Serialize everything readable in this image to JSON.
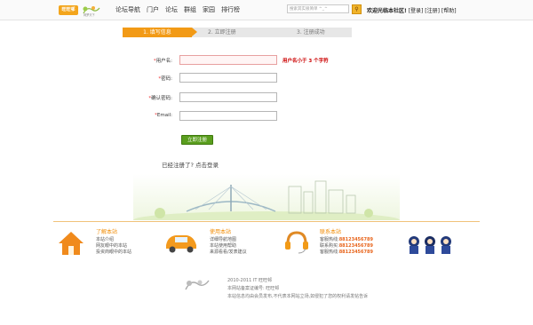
{
  "header": {
    "logo_text": "旺旺邨",
    "logo_slogan": "网罗天下",
    "nav": [
      "论坛导航",
      "门户",
      "论坛",
      "群组",
      "家园",
      "排行榜"
    ],
    "search_placeholder": "搜索其实很简单 ^_^",
    "search_button_icon": "search-icon",
    "welcome": "欢迎光临本社区!",
    "login_link": "[登录]",
    "register_link": "[注册]",
    "help_link": "[帮助]"
  },
  "steps": {
    "step1": "1. 填写信息",
    "step2": "2. 立即注册",
    "step3": "3. 注册成功"
  },
  "form": {
    "username_label": "用户名:",
    "username_hint": "用户名小于 3 个字符",
    "password_label": "密码:",
    "confirm_label": "确认密码:",
    "email_label": "Email:",
    "submit": "立即注册",
    "already_registered": "已经注册了? 点击登录"
  },
  "footer": {
    "col1": {
      "title": "了解本站",
      "items": [
        "本站介绍",
        "网友眼中的本站",
        "投资商眼中的本站"
      ]
    },
    "col2": {
      "title": "使用本站",
      "items": [
        "详细导航地图",
        "本站使用帮助",
        "来源看看/发表建议"
      ]
    },
    "col3": {
      "title": "联系本站",
      "items": [
        {
          "label": "客服热线:",
          "num": "88123456789"
        },
        {
          "label": "联系购买:",
          "num": "88123456789"
        },
        {
          "label": "客服热线:",
          "num": "88123456789"
        }
      ]
    },
    "copyright_line1": "2010-2011 IT 旺旺邨",
    "copyright_line2": "本网站备案证编号: 旺旺邨",
    "copyright_line3": "本站信息均由会员发布,不代表本网站立场,如侵犯了您的权利请发帖告诉"
  },
  "colors": {
    "accent": "#f29a16",
    "submit": "#5a9e1e",
    "error": "#cc0000"
  }
}
